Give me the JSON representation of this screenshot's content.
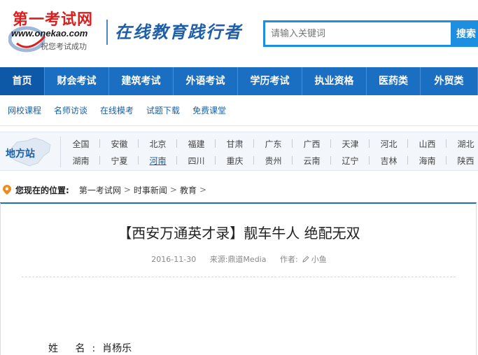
{
  "header": {
    "logo_title": "第一考试网",
    "logo_url": "www.onekao.com",
    "logo_sub": "祝您考试成功",
    "slogan": "在线教育践行者",
    "search": {
      "placeholder": "请输入关键词",
      "button": "搜索"
    }
  },
  "mainnav": [
    {
      "label": "首页",
      "active": true
    },
    {
      "label": "财会考试"
    },
    {
      "label": "建筑考试"
    },
    {
      "label": "外语考试"
    },
    {
      "label": "学历考试"
    },
    {
      "label": "执业资格"
    },
    {
      "label": "医药类"
    },
    {
      "label": "外贸类"
    }
  ],
  "subnav": [
    "网校课程",
    "名师访谈",
    "在线模考",
    "试题下载",
    "免费课堂"
  ],
  "region": {
    "label": "地方站",
    "row1": [
      "全国",
      "安徽",
      "北京",
      "福建",
      "甘肃",
      "广东",
      "广西",
      "天津",
      "河北",
      "山西",
      "湖北"
    ],
    "row2": [
      "湖南",
      "宁夏",
      "河南",
      "四川",
      "重庆",
      "贵州",
      "云南",
      "辽宁",
      "吉林",
      "海南",
      "陕西"
    ],
    "highlighted": "河南"
  },
  "breadcrumb": {
    "label": "您现在的位置:",
    "items": [
      "第一考试网",
      "时事新闻",
      "教育"
    ]
  },
  "article": {
    "title": "【西安万通英才录】靓车牛人 绝配无双",
    "date": "2016-11-30",
    "source_label": "来源:",
    "source": "鼎道Media",
    "author_label": "作者:",
    "author": "小鱼",
    "body_label": "姓 名:",
    "body_value": "肖杨乐"
  },
  "colors": {
    "nav_blue": "#1b6fc3",
    "nav_active": "#0d59a8",
    "search_blue": "#1d8ee0",
    "logo_red": "#d9201f",
    "link_blue": "#1b5fa5"
  }
}
